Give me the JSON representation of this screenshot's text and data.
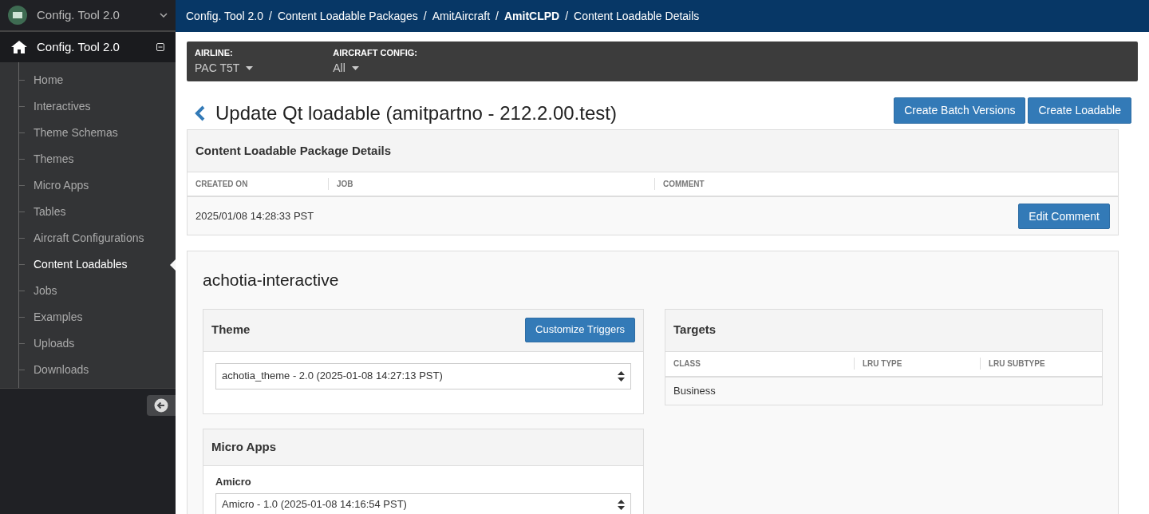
{
  "app_switcher": {
    "title": "Config. Tool 2.0"
  },
  "sidebar": {
    "header": "Config. Tool 2.0",
    "items": [
      {
        "label": "Home",
        "selected": false
      },
      {
        "label": "Interactives",
        "selected": false
      },
      {
        "label": "Theme Schemas",
        "selected": false
      },
      {
        "label": "Themes",
        "selected": false
      },
      {
        "label": "Micro Apps",
        "selected": false
      },
      {
        "label": "Tables",
        "selected": false
      },
      {
        "label": "Aircraft Configurations",
        "selected": false
      },
      {
        "label": "Content Loadables",
        "selected": true
      },
      {
        "label": "Jobs",
        "selected": false
      },
      {
        "label": "Examples",
        "selected": false
      },
      {
        "label": "Uploads",
        "selected": false
      },
      {
        "label": "Downloads",
        "selected": false
      }
    ]
  },
  "breadcrumb_separator": "/",
  "breadcrumbs": [
    {
      "label": "Config. Tool 2.0",
      "current": false
    },
    {
      "label": "Content Loadable Packages",
      "current": false
    },
    {
      "label": "AmitAircraft",
      "current": false
    },
    {
      "label": "AmitCLPD",
      "current": true
    },
    {
      "label": "Content Loadable Details",
      "current": false
    }
  ],
  "filters": [
    {
      "label": "AIRLINE:",
      "value": "PAC T5T"
    },
    {
      "label": "AIRCRAFT CONFIG:",
      "value": "All"
    }
  ],
  "page_title": "Update Qt loadable (amitpartno - 212.2.00.test)",
  "header_buttons": [
    "Create Batch Versions",
    "Create Loadable"
  ],
  "details": {
    "title": "Content Loadable Package Details",
    "columns": [
      "CREATED ON",
      "JOB",
      "COMMENT"
    ],
    "created_on": "2025/01/08 14:28:33 PST",
    "button": "Edit Comment"
  },
  "interactive": {
    "title": "achotia-interactive",
    "theme": {
      "title": "Theme",
      "button": "Customize Triggers",
      "value": "achotia_theme - 2.0 (2025-01-08 14:27:13 PST)"
    },
    "micro_apps": {
      "title": "Micro Apps",
      "items": [
        {
          "label": "Amicro",
          "value": "Amicro - 1.0 (2025-01-08 14:16:54 PST)"
        }
      ]
    },
    "targets": {
      "title": "Targets",
      "columns": [
        "CLASS",
        "LRU TYPE",
        "LRU SUBTYPE"
      ],
      "rows": [
        [
          "Business",
          "",
          ""
        ]
      ]
    }
  }
}
